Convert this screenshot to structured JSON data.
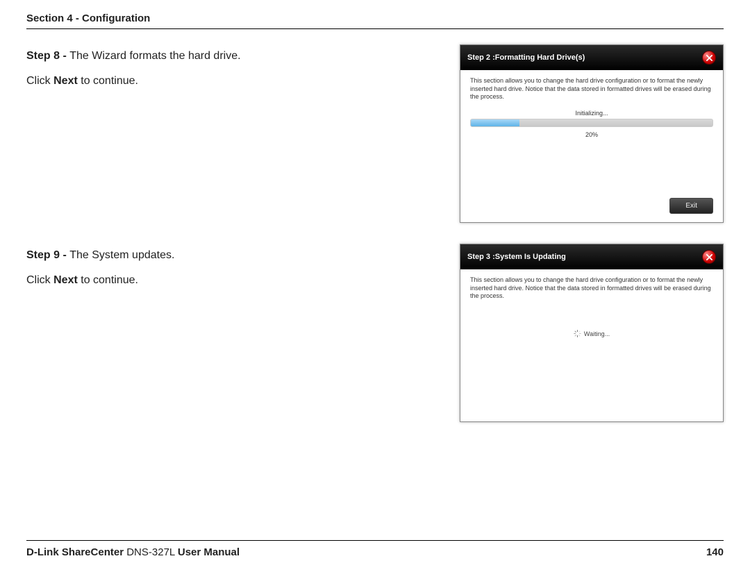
{
  "header": {
    "section": "Section 4 - Configuration"
  },
  "step8": {
    "label": "Step 8 - ",
    "text": "The Wizard formats the hard drive.",
    "hint_pre": "Click ",
    "hint_b": "Next",
    "hint_post": " to continue."
  },
  "step9": {
    "label": "Step 9 - ",
    "text": "The System updates.",
    "hint_pre": "Click ",
    "hint_b": "Next",
    "hint_post": " to continue."
  },
  "dialog1": {
    "title": "Step 2 :Formatting Hard Drive(s)",
    "desc": "This section allows you to change the hard drive configuration or to format the newly inserted hard drive. Notice that the data stored in formatted drives will be erased during the process.",
    "init": "Initializing...",
    "pct": "20%",
    "exit": "Exit"
  },
  "dialog2": {
    "title": "Step 3 :System Is Updating",
    "desc": "This section allows you to change the hard drive configuration or to format the newly inserted hard drive. Notice that the data stored in formatted drives will be erased during the process.",
    "waiting": "Waiting..."
  },
  "footer": {
    "brand_b1": "D-Link ShareCenter",
    "model": " DNS-327L ",
    "brand_b2": "User Manual",
    "page": "140"
  }
}
